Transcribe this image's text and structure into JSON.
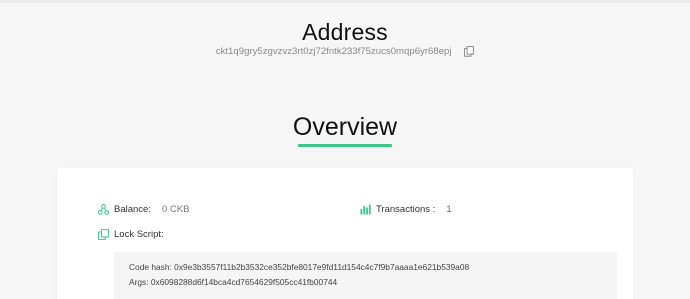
{
  "header": {
    "title": "Address",
    "address": "ckt1q9gry5zgvzvz3rt0zj72fntk233f75zucs0mqp6yr68epj"
  },
  "overview": {
    "title": "Overview",
    "balance_label": "Balance:",
    "balance_value": "0 CKB",
    "transactions_label": "Transactions :",
    "transactions_value": "1",
    "lock_script_label": "Lock Script:",
    "code_hash_label": "Code hash:",
    "code_hash_value": "0x9e3b3557f11b2b3532ce352bfe8017e9fd11d154c4c7f9b7aaaa1e621b539a08",
    "args_label": "Args:",
    "args_value": "0x6098288d6f14bca4cd7654629f505cc41fb00744"
  },
  "colors": {
    "accent": "#3cc68a",
    "background": "#f6f6f6",
    "card": "#ffffff"
  },
  "icons": [
    "copy-icon",
    "balance-icon",
    "transactions-icon",
    "lock-script-icon"
  ]
}
